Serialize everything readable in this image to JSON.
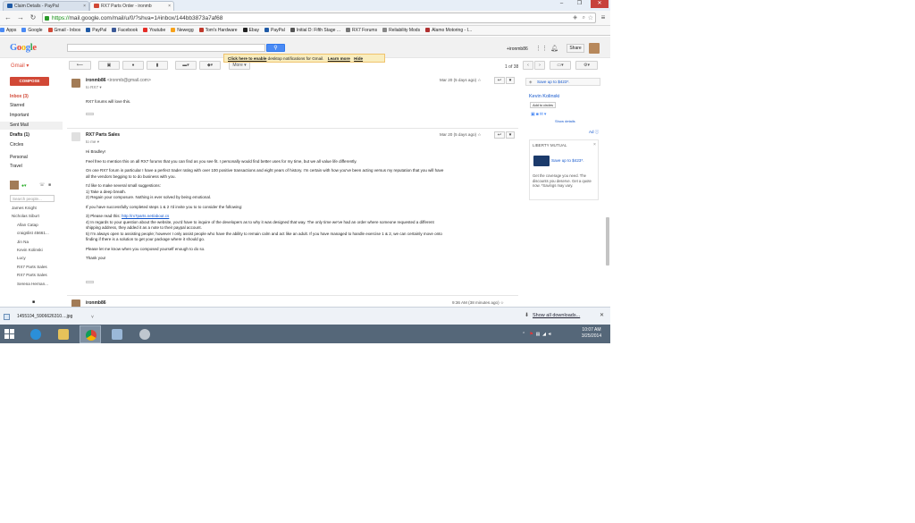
{
  "browser": {
    "tabs": [
      {
        "label": "Claim Details - PayPal",
        "favicon_color": "#1f5aa6"
      },
      {
        "label": "RX7 Parts Order - ironmb",
        "favicon_color": "#d14836"
      }
    ],
    "url_scheme": "https://",
    "url_rest": "mail.google.com/mail/u/0/?shva=1#inbox/144bb3873a7af68",
    "bookmarks": [
      {
        "label": "Apps",
        "icon": "apps-grid-icon",
        "color": "#4a8af4"
      },
      {
        "label": "Google",
        "icon": "google-icon",
        "color": "#4a8af4"
      },
      {
        "label": "Gmail - Inbox",
        "icon": "gmail-icon",
        "color": "#d14836"
      },
      {
        "label": "PayPal",
        "icon": "paypal-icon",
        "color": "#1f5aa6"
      },
      {
        "label": "Facebook",
        "icon": "facebook-icon",
        "color": "#3b5998"
      },
      {
        "label": "Youtube",
        "icon": "youtube-icon",
        "color": "#e52d27"
      },
      {
        "label": "Newegg",
        "icon": "newegg-icon",
        "color": "#f7a21b"
      },
      {
        "label": "Tom's Hardware",
        "icon": "toms-hardware-icon",
        "color": "#c0392b"
      },
      {
        "label": "Ebay",
        "icon": "ebay-icon",
        "color": "#222222"
      },
      {
        "label": "PayPal",
        "icon": "paypal-icon",
        "color": "#1f5aa6"
      },
      {
        "label": "Initial D: Fifth Stage ...",
        "icon": "anime-icon",
        "color": "#555555"
      },
      {
        "label": "RX7 Forums",
        "icon": "rx7-icon",
        "color": "#777777"
      },
      {
        "label": "Reliability Mods",
        "icon": "reliability-icon",
        "color": "#888888"
      },
      {
        "label": "Alamo Motoring - I...",
        "icon": "alamo-icon",
        "color": "#b03030"
      }
    ]
  },
  "gmail": {
    "logo": "Google",
    "gmail_label": "Gmail ▾",
    "username": "+ironmb86",
    "share_label": "Share",
    "notification": {
      "link": "Click here to enable",
      "text": " desktop notifications for Gmail.",
      "learn": "Learn more",
      "hide": "Hide"
    },
    "more_label": "More ▾",
    "page_info": "1 of 38",
    "compose_label": "COMPOSE",
    "nav": [
      {
        "label": "Inbox (3)",
        "style": "inbox"
      },
      {
        "label": "Starred",
        "style": ""
      },
      {
        "label": "Important",
        "style": ""
      },
      {
        "label": "Sent Mail",
        "style": "sel"
      },
      {
        "label": "Drafts (1)",
        "style": "bold"
      },
      {
        "label": "Circles",
        "style": ""
      },
      {
        "label": "Personal",
        "style": ""
      },
      {
        "label": "Travel",
        "style": ""
      }
    ],
    "people_search_placeholder": "Search people...",
    "people": [
      "James Knight",
      "Nicholas Siburt",
      "Allan Catap",
      "craigslist 45661...",
      "Jin Na",
      "Kevin Kolinski",
      "Lucy",
      "RX7 Parts Sales",
      "RX7 Parts Sales",
      "Serena Hernan..."
    ],
    "messages": [
      {
        "sender": "ironmb86",
        "email": "<ironmb@gmail.com>",
        "to": "to RX7 ▾",
        "date": "Mar 20 (5 days ago) ☆",
        "lines": [
          "RX7 forums will love this."
        ]
      },
      {
        "sender": "RX7 Parts Sales",
        "email": "",
        "to": "to me ▾",
        "date": "Mar 20 (5 days ago) ☆",
        "lines": [
          "Hi Bradley!",
          "",
          "Feel free to mention this on all RX7 forums that you can find as you see fit. I personally would find better uses for my time, but we all value life differently.",
          "",
          "On one RX7 forum in particular I have a perfect trader rating with over 100 positive transactions and eight years of history. I'm certain with how you've been acting versus my reputation that you will have",
          "all the vendors begging to to do business with you.",
          "",
          "I'd like to make several small suggestions:",
          "1) Take a deep breath.",
          "2) Regain your composure. Nothing is ever solved by being emotional.",
          "",
          "If you have successfully completed steps 1 & 2 I'd invite you to to consider the following:",
          "",
          "3) Please read this: ",
          "4) In regards to your question about the website, you'd have to inquire of the developers as to why it was designed that way. The only time we've had an order where someone requested a different",
          "shipping address, they added it as a note to their paypal account.",
          "5) I'm always open to assisting people; however I only assist people who have the ability to remain calm and act like an adult. If you have managed to handle exercise 1 & 2, we can certainly move onto",
          "finding if there is a solution to get your package where it should go.",
          "",
          "Please let me know when you composed yourself enough to do so.",
          "",
          "Thank you!"
        ],
        "link": "http://rx7parts.net/about.cs"
      },
      {
        "sender": "ironmb86",
        "email": "",
        "date": "9:36 AM (38 minutes ago) ☆"
      }
    ],
    "right": {
      "promo": "Save up to $423*.",
      "contact": "Kevin Kolinski",
      "add_circles": "Add to circles",
      "show_details": "Show details",
      "ad_label": "Ad ⓘ",
      "ad_title": "LIBERTY MUTUAL",
      "ad_headline": "Save up to $423*.",
      "ad_text": "Get the coverage you need. The discounts you deserve. Get a quote now. *Savings may vary."
    }
  },
  "download": {
    "filename": "1455104_5906626310....jpg",
    "show_all": "Show all downloads...",
    "close": "✕"
  },
  "taskbar": {
    "time": "10:07 AM",
    "date": "3/25/2014"
  }
}
